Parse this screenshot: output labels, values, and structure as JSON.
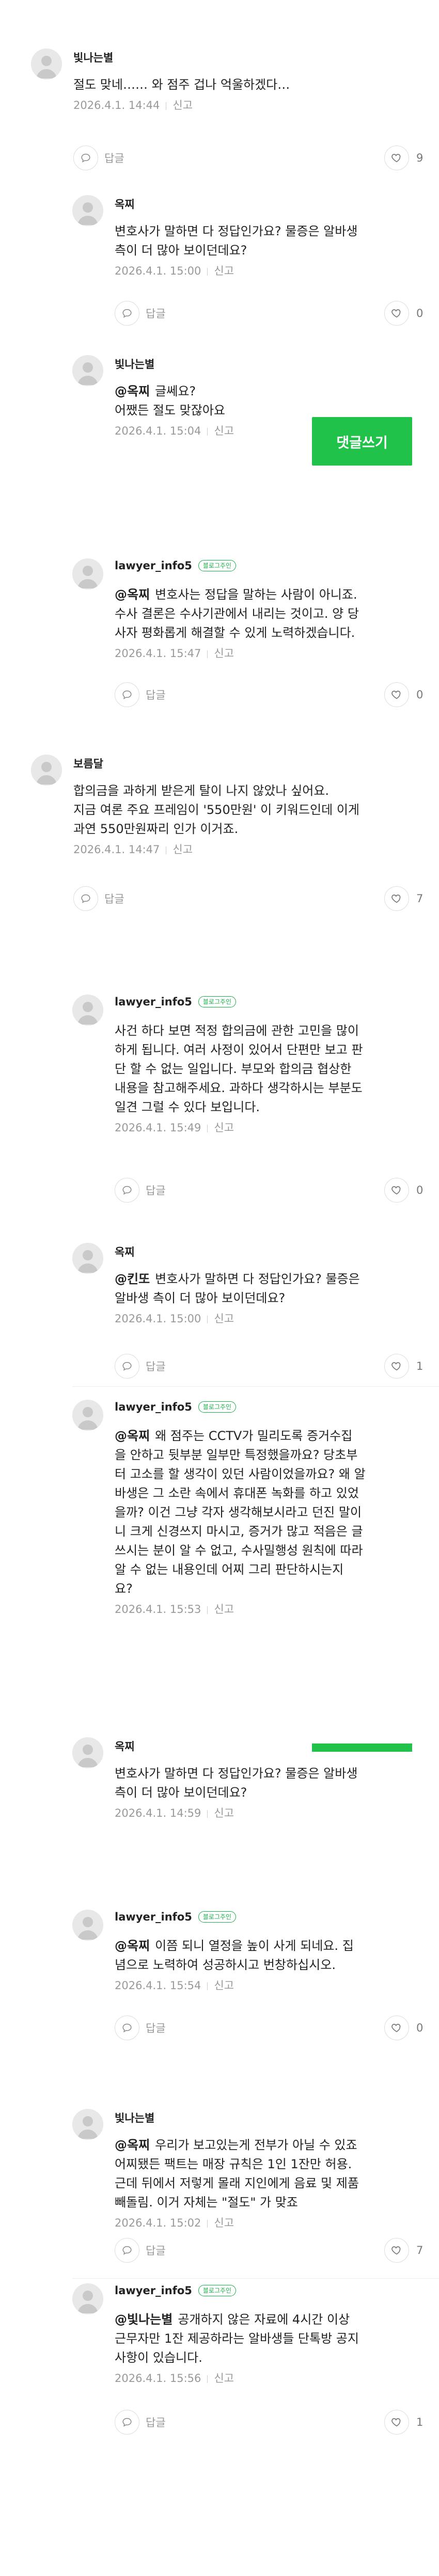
{
  "ui": {
    "reply_label": "답글",
    "report_label": "신고",
    "write_reply_button": "댓글쓰기",
    "badge_label": "블로그주인"
  },
  "comments": [
    {
      "author": "빛나는별",
      "lines": [
        "절도 맞네…… 와 점주 겁나 억울하겠다…"
      ],
      "date": "2026.4.1. 14:44",
      "likes": "9"
    },
    {
      "author": "옥찌",
      "lines": [
        "변호사가 말하면 다 정답인가요? 물증은 알바생",
        "측이 더 많아 보이던데요?"
      ],
      "date": "2026.4.1. 15:00",
      "likes": "0"
    },
    {
      "author": "빛나는별",
      "mention": "@옥찌",
      "lines": [
        "글쎄요?",
        "어쨌든 절도 맞잖아요"
      ],
      "date": "2026.4.1. 15:04"
    },
    {
      "author": "lawyer_info5",
      "owner": true,
      "mention": "@옥찌",
      "lines": [
        "변호사는 정답을 말하는 사람이 아니죠.",
        "수사 결론은 수사기관에서 내리는 것이고. 양 당",
        "사자 평화롭게 해결할 수 있게 노력하겠습니다."
      ],
      "date": "2026.4.1. 15:47",
      "likes": "0"
    },
    {
      "author": "보름달",
      "lines": [
        "합의금을 과하게 받은게 탈이 나지 않았나 싶어요.",
        "지금 여론 주요 프레임이 '550만원' 이 키워드인데 이게",
        "과연 550만원짜리 인가 이거죠."
      ],
      "date": "2026.4.1. 14:47",
      "likes": "7"
    },
    {
      "author": "lawyer_info5",
      "owner": true,
      "lines": [
        "사건 하다 보면 적정 합의금에 관한 고민을 많이",
        "하게 됩니다. 여러 사정이 있어서 단편만 보고 판",
        "단 할 수 없는 일입니다. 부모와 합의금 협상한",
        "내용을 참고해주세요. 과하다 생각하시는 부분도",
        "일견 그럴 수 있다 보입니다."
      ],
      "date": "2026.4.1. 15:49",
      "likes": "0"
    },
    {
      "author": "옥찌",
      "mention": "@킨또",
      "lines": [
        "변호사가 말하면 다 정답인가요? 물증은",
        "알바생 측이 더 많아 보이던데요?"
      ],
      "date": "2026.4.1. 15:00",
      "likes": "1"
    },
    {
      "author": "lawyer_info5",
      "owner": true,
      "mention": "@옥찌",
      "lines": [
        "왜 점주는 CCTV가 밀리도록 증거수집",
        "을 안하고 뒷부분 일부만 특정했을까요? 당초부",
        "터 고소를 할 생각이 있던 사람이었을까요? 왜 알",
        "바생은 그 소란 속에서 휴대폰 녹화를 하고 있었",
        "을까? 이건 그냥 각자 생각해보시라고 던진 말이",
        "니 크게 신경쓰지 마시고, 증거가 많고 적음은 글",
        "쓰시는 분이 알 수 없고, 수사밀행성 원칙에 따라",
        "알 수 없는 내용인데 어찌 그리 판단하시는지",
        "요?"
      ],
      "date": "2026.4.1. 15:53"
    },
    {
      "author": "옥찌",
      "lines": [
        "변호사가 말하면 다 정답인가요? 물증은 알바생",
        "측이 더 많아 보이던데요?"
      ],
      "date": "2026.4.1. 14:59"
    },
    {
      "author": "lawyer_info5",
      "owner": true,
      "mention": "@옥찌",
      "lines": [
        "이쯤 되니 열정을 높이 사게 되네요. 집",
        "념으로 노력하여 성공하시고 번창하십시오."
      ],
      "date": "2026.4.1. 15:54",
      "likes": "0"
    },
    {
      "author": "빛나는별",
      "mention": "@옥찌",
      "lines": [
        "우리가 보고있는게 전부가 아닐 수 있죠",
        "어찌됐든 팩트는 매장 규칙은 1인 1잔만 허용.",
        "근데 뒤에서 저렇게 몰래 지인에게 음료 및 제품",
        "빼돌림. 이거 자체는 \"절도\" 가 맞죠"
      ],
      "date": "2026.4.1. 15:02",
      "likes": "7"
    },
    {
      "author": "lawyer_info5",
      "owner": true,
      "mention": "@빛나는별",
      "lines": [
        "공개하지 않은 자료에 4시간 이상",
        "근무자만 1잔 제공하라는 알바생들 단톡방 공지",
        "사항이 있습니다."
      ],
      "date": "2026.4.1. 15:56",
      "likes": "1"
    }
  ]
}
